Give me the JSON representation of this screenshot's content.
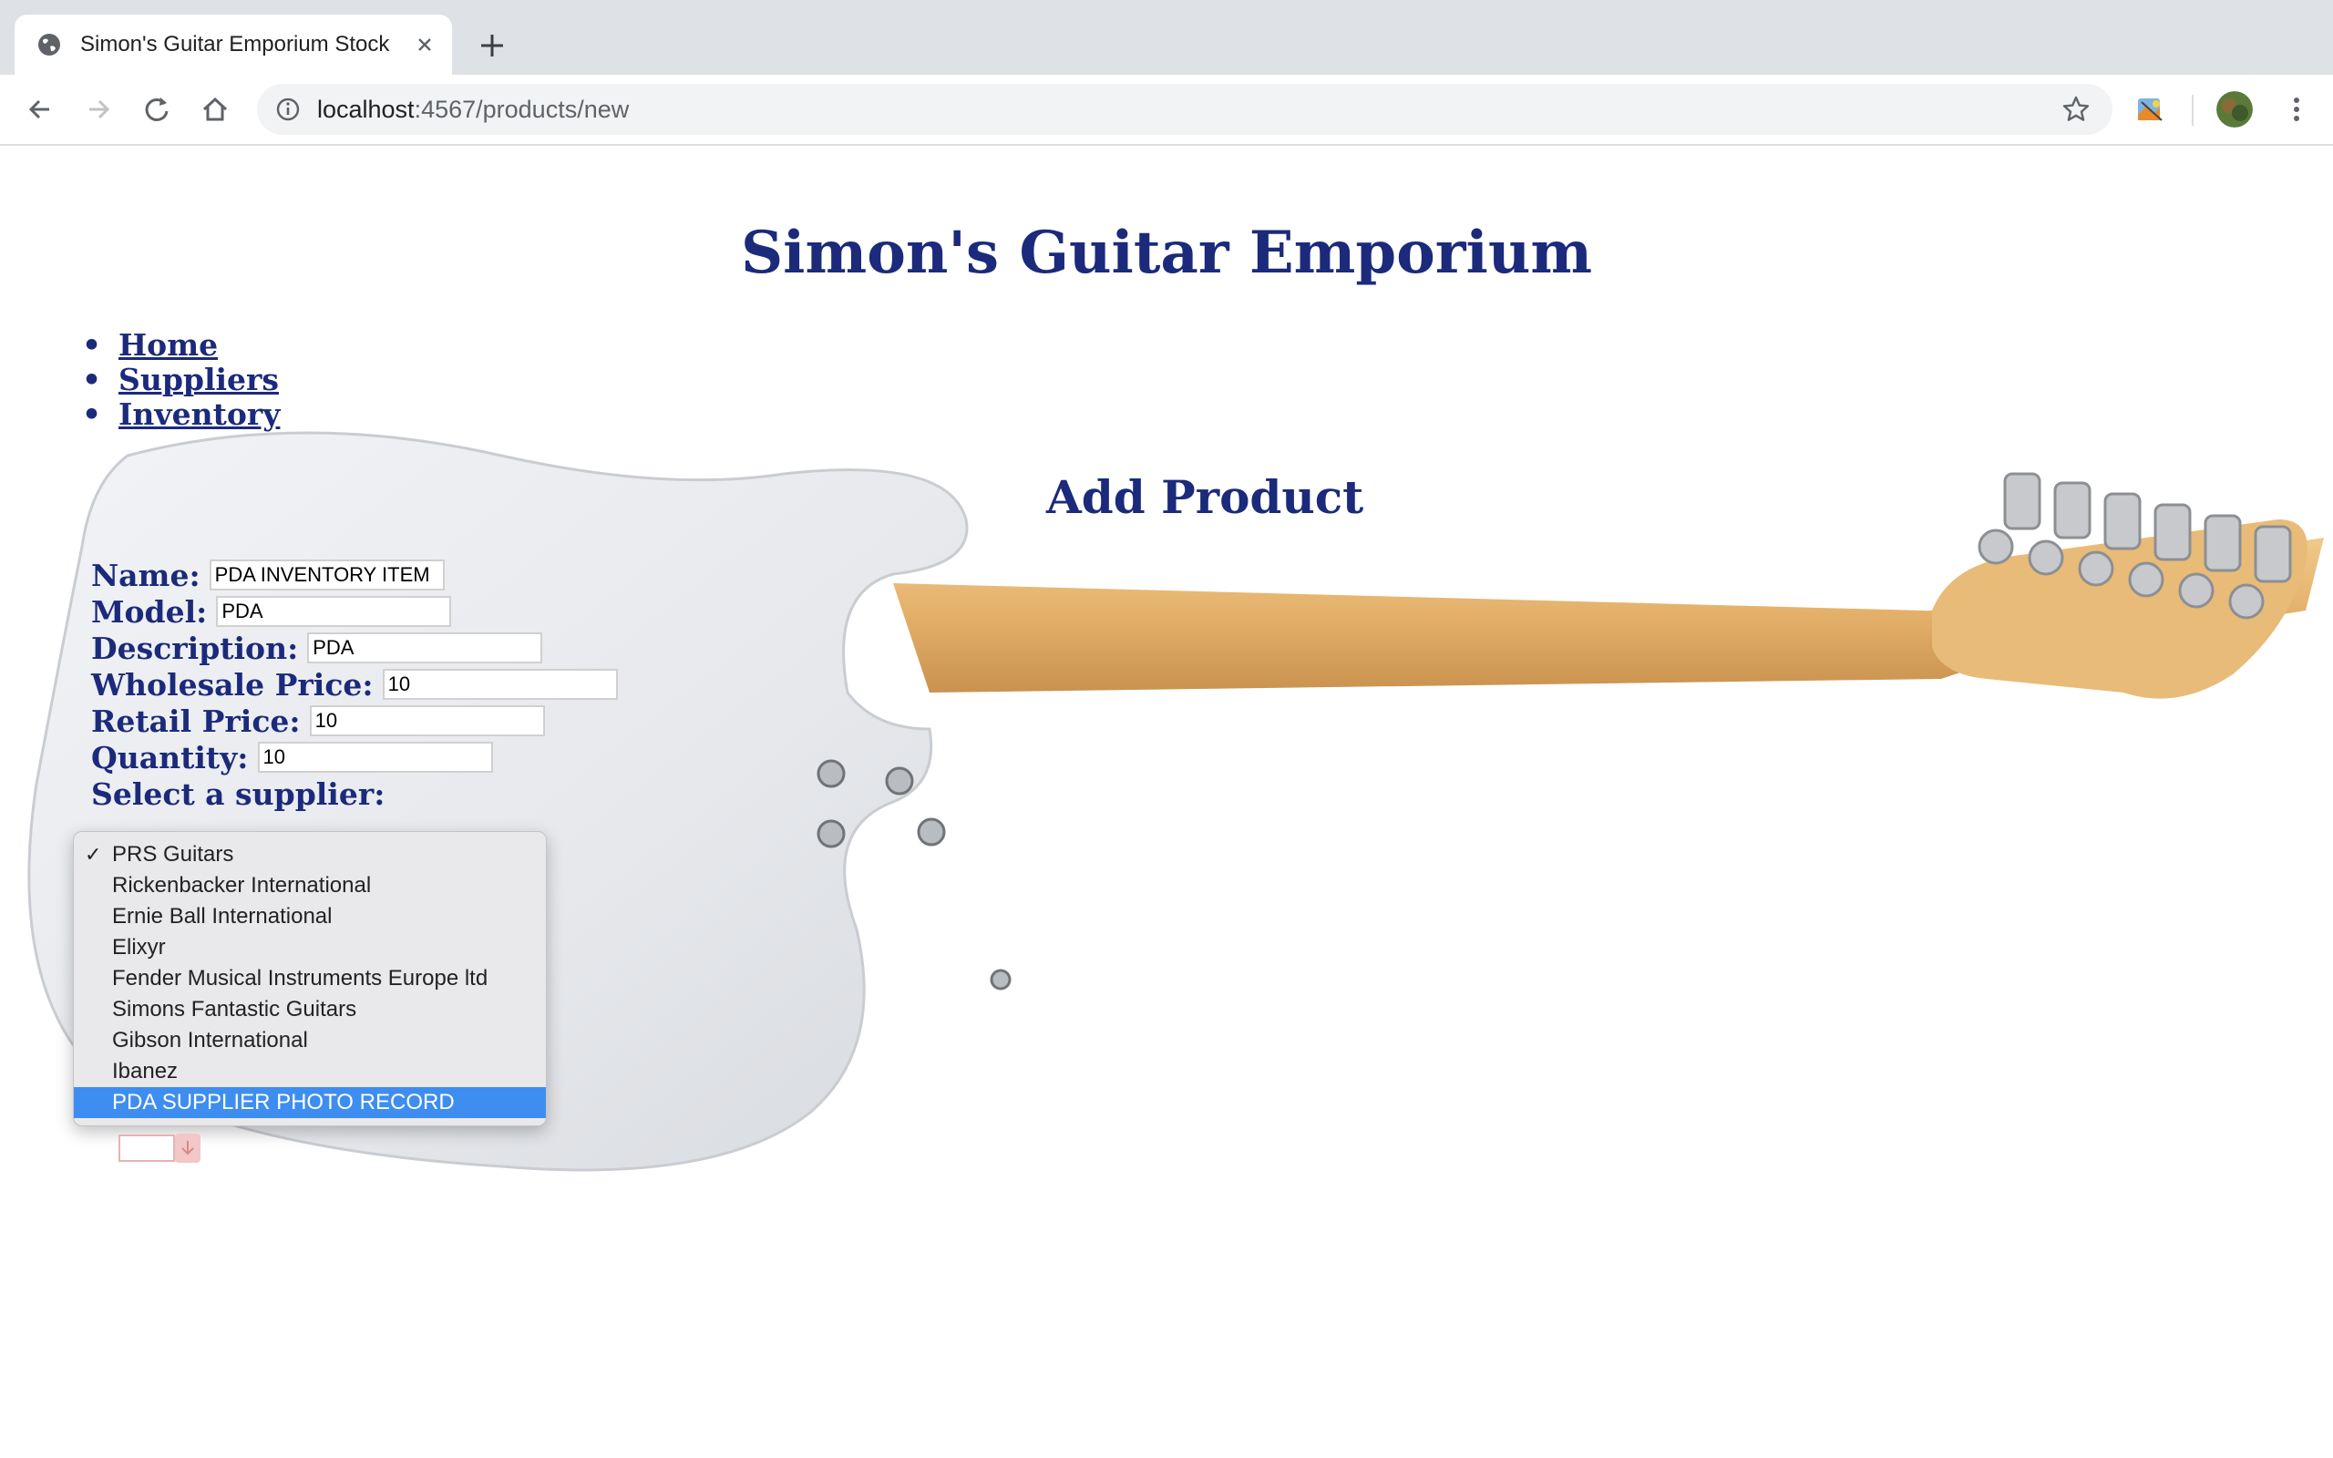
{
  "browser": {
    "tab_title": "Simon's Guitar Emporium Stock",
    "url_host": "localhost",
    "url_rest": ":4567/products/new"
  },
  "site": {
    "title": "Simon's Guitar Emporium"
  },
  "nav": {
    "items": [
      {
        "label": "Home"
      },
      {
        "label": "Suppliers"
      },
      {
        "label": "Inventory"
      }
    ]
  },
  "form": {
    "title": "Add Product",
    "fields": [
      {
        "label": "Name:",
        "value": "PDA INVENTORY ITEM"
      },
      {
        "label": "Model:",
        "value": "PDA"
      },
      {
        "label": "Description:",
        "value": "PDA"
      },
      {
        "label": "Wholesale Price:",
        "value": "10"
      },
      {
        "label": "Retail Price:",
        "value": "10"
      },
      {
        "label": "Quantity:",
        "value": "10"
      }
    ],
    "supplier_label": "Select a supplier:",
    "supplier_options": [
      {
        "label": "PRS Guitars",
        "checked": true
      },
      {
        "label": "Rickenbacker International"
      },
      {
        "label": "Ernie Ball International"
      },
      {
        "label": "Elixyr"
      },
      {
        "label": "Fender Musical Instruments Europe ltd"
      },
      {
        "label": "Simons Fantastic Guitars"
      },
      {
        "label": "Gibson International"
      },
      {
        "label": "Ibanez"
      },
      {
        "label": "PDA SUPPLIER PHOTO RECORD",
        "highlighted": true
      }
    ],
    "check_glyph": "✓"
  },
  "colors": {
    "heading": "#1b2a7a",
    "selection": "#3e8df0",
    "chrome": "#dee1e6"
  },
  "icons": [
    "globe-icon",
    "close-icon",
    "plus-icon",
    "back-icon",
    "forward-icon",
    "reload-icon",
    "home-icon",
    "info-icon",
    "star-icon",
    "extension-icon",
    "avatar",
    "menu-icon"
  ]
}
